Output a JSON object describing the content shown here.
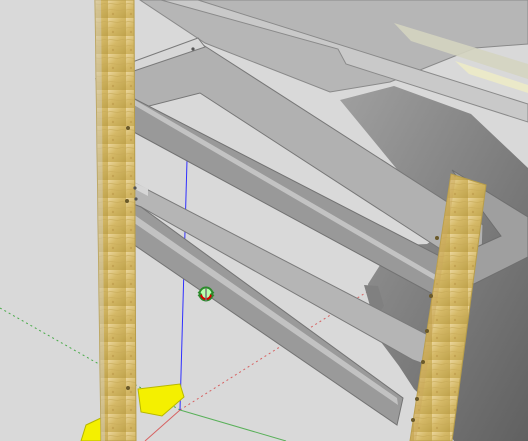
{
  "scene": {
    "kind": "3D model viewport",
    "background_color": "#d9d9d9",
    "wood_color": "#d9bf6a",
    "metal_color": "#b8b8b8",
    "dark_metal_color": "#6c6c6c",
    "highlight_color": "#f4f000",
    "axis_colors": {
      "x": "#d64545",
      "y": "#3aa63a",
      "z": "#2f2fff"
    },
    "cursor_icon": "orbit-cursor-icon"
  }
}
